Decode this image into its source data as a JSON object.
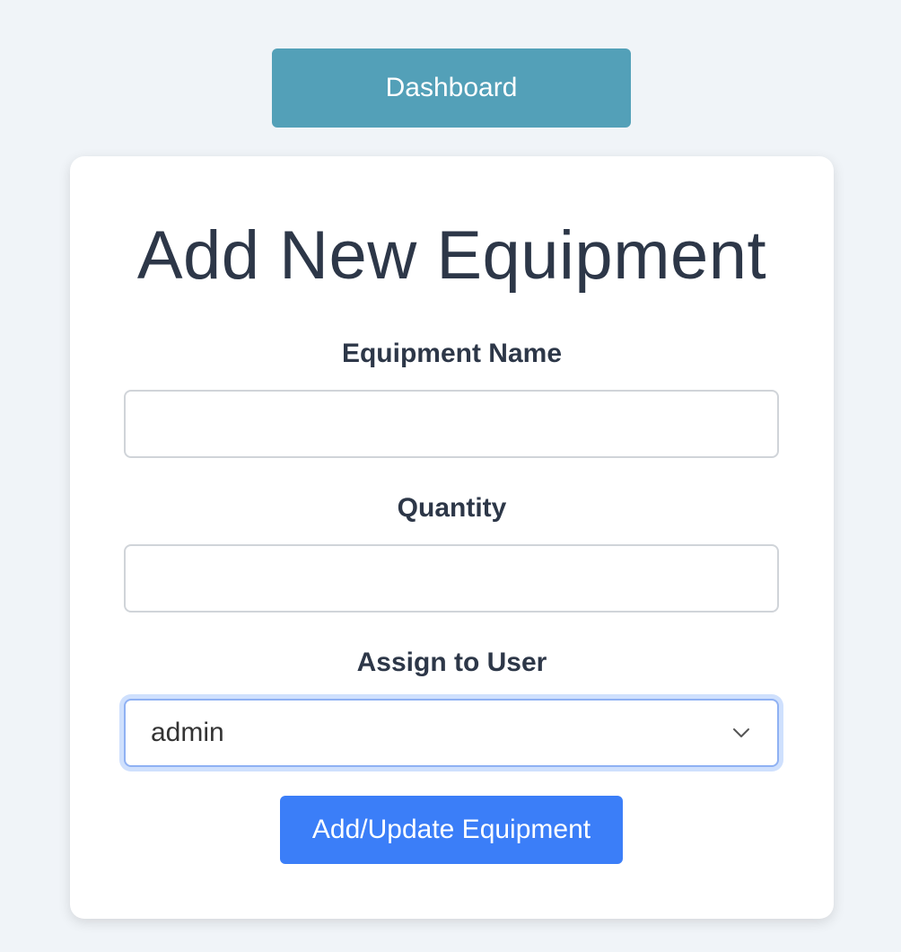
{
  "nav": {
    "dashboard_label": "Dashboard"
  },
  "form": {
    "title": "Add New Equipment",
    "equipment_name": {
      "label": "Equipment Name",
      "value": ""
    },
    "quantity": {
      "label": "Quantity",
      "value": ""
    },
    "assign_user": {
      "label": "Assign to User",
      "selected": "admin",
      "icon": "chevron-down-icon"
    },
    "submit_label": "Add/Update Equipment"
  },
  "colors": {
    "background": "#f0f4f8",
    "dashboard_button": "#53a0b8",
    "submit_button": "#3b7ef8",
    "heading_text": "#2d3748",
    "focus_ring": "#cfe0fd"
  }
}
